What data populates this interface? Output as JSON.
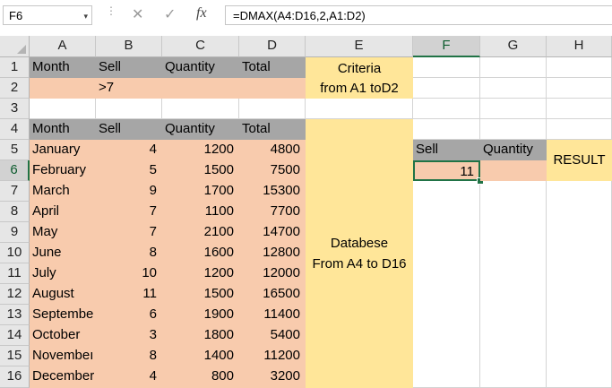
{
  "name_box": "F6",
  "formula": "=DMAX(A4:D16,2,A1:D2)",
  "icons": {
    "cancel": "✕",
    "enter": "✓",
    "fx": "fx",
    "dropdown": "▾"
  },
  "columns": [
    "A",
    "B",
    "C",
    "D",
    "E",
    "F",
    "G",
    "H"
  ],
  "rows": [
    "1",
    "2",
    "3",
    "4",
    "5",
    "6",
    "7",
    "8",
    "9",
    "10",
    "11",
    "12",
    "13",
    "14",
    "15",
    "16"
  ],
  "criteria_headers": [
    "Month",
    "Sell",
    "Quantity",
    "Total"
  ],
  "criteria_value_sell": ">7",
  "criteria_label": [
    "Criteria",
    "from A1 toD2"
  ],
  "database_headers": [
    "Month",
    "Sell",
    "Quantity",
    "Total"
  ],
  "database_rows": [
    [
      "January",
      "4",
      "1200",
      "4800"
    ],
    [
      "February",
      "5",
      "1500",
      "7500"
    ],
    [
      "March",
      "9",
      "1700",
      "15300"
    ],
    [
      "April",
      "7",
      "1100",
      "7700"
    ],
    [
      "May",
      "7",
      "2100",
      "14700"
    ],
    [
      "June",
      "8",
      "1600",
      "12800"
    ],
    [
      "July",
      "10",
      "1200",
      "12000"
    ],
    [
      "August",
      "11",
      "1500",
      "16500"
    ],
    [
      "Septembe",
      "6",
      "1900",
      "11400"
    ],
    [
      "October",
      "3",
      "1800",
      "5400"
    ],
    [
      "Novembeı",
      "8",
      "1400",
      "11200"
    ],
    [
      "December",
      "4",
      "800",
      "3200"
    ]
  ],
  "database_label": [
    "Databese",
    "From A4 to D16"
  ],
  "result_headers": [
    "Sell",
    "Quantity"
  ],
  "result_value": "11",
  "result_label": "RESULT",
  "colors": {
    "gray": "#a6a6a6",
    "peach": "#f8cbad",
    "yellow": "#ffe699",
    "accent": "#217346"
  }
}
